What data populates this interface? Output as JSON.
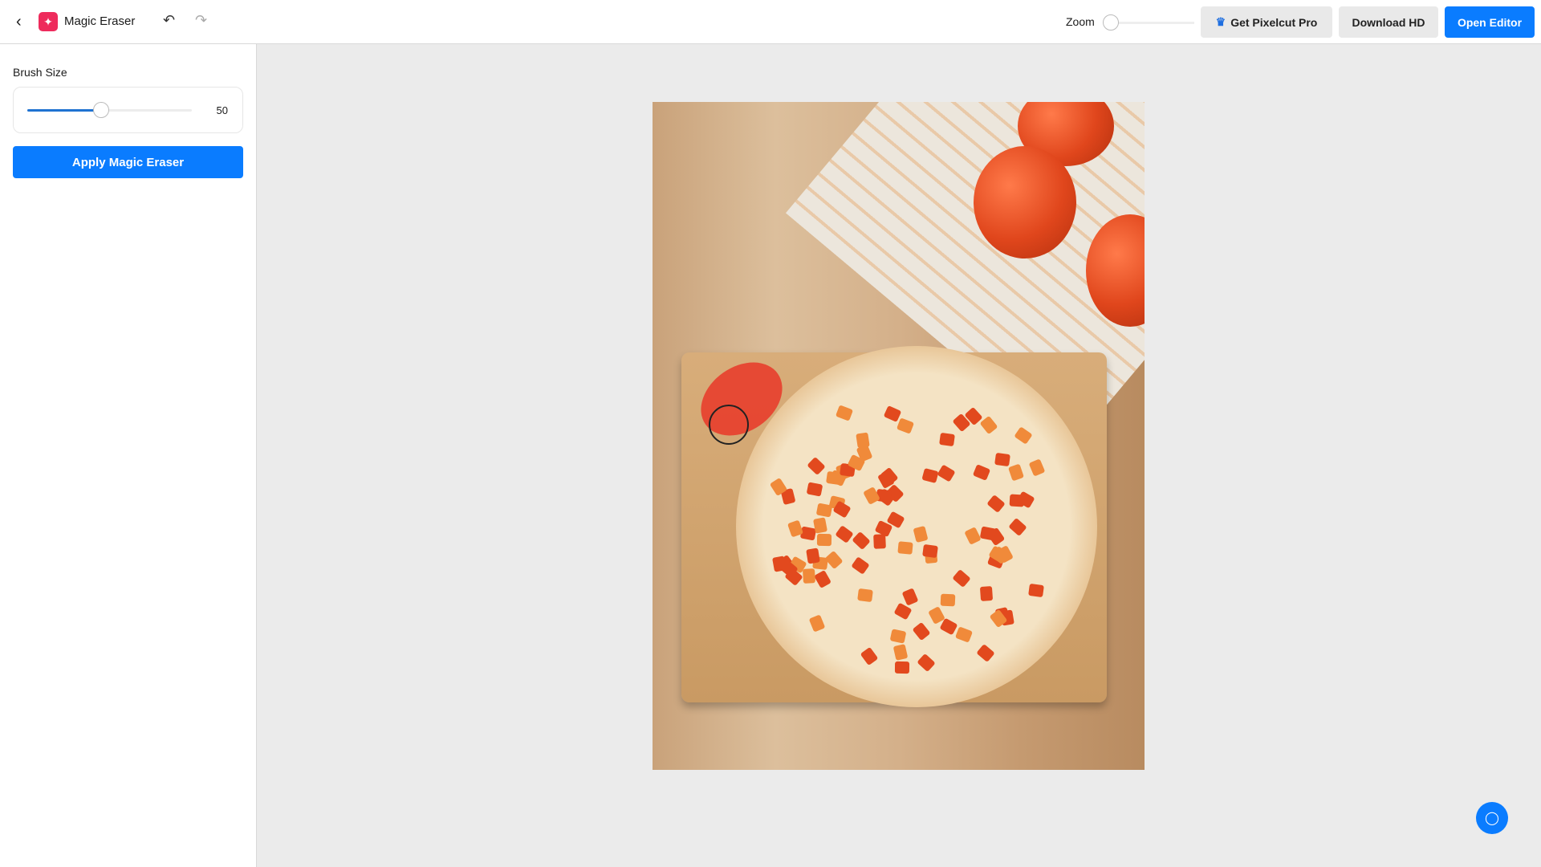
{
  "header": {
    "title": "Magic Eraser",
    "zoom_label": "Zoom",
    "zoom_level": 0,
    "get_pro_label": "Get Pixelcut Pro",
    "download_label": "Download HD",
    "open_editor_label": "Open Editor"
  },
  "sidebar": {
    "brush_size_label": "Brush Size",
    "brush_size_value": "50",
    "brush_size_fraction": 0.45,
    "apply_label": "Apply Magic Eraser"
  },
  "colors": {
    "accent": "#0a7cff",
    "app_icon": "#ee2b5c",
    "mask": "#eb281e"
  },
  "icons": [
    "back-arrow-icon",
    "magic-eraser-icon",
    "undo-icon",
    "redo-icon",
    "crown-icon",
    "chat-icon"
  ]
}
